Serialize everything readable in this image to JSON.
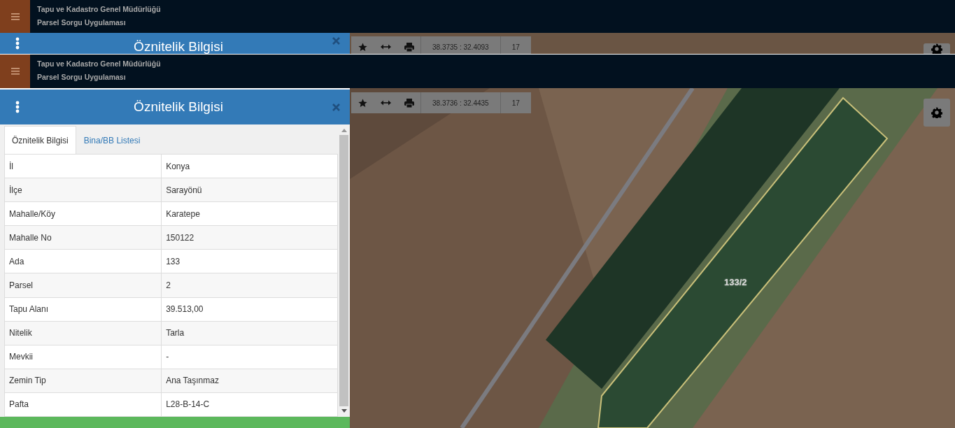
{
  "frames": [
    {
      "header": {
        "title": "Tapu ve Kadastro Genel Müdürlüğü",
        "subtitle": "Parsel Sorgu Uygulaması"
      },
      "panel": {
        "title": "Öznitelik Bilgisi"
      },
      "toolbar": {
        "coordinates": "38.3735 : 32.4093",
        "zoom": "17"
      }
    },
    {
      "header": {
        "title": "Tapu ve Kadastro Genel Müdürlüğü",
        "subtitle": "Parsel Sorgu Uygulaması"
      },
      "panel": {
        "title": "Öznitelik Bilgisi",
        "tabs": [
          {
            "label": "Öznitelik Bilgisi",
            "selected": true
          },
          {
            "label": "Bina/BB Listesi",
            "selected": false
          }
        ],
        "rows": [
          {
            "label": "İl",
            "value": "Konya"
          },
          {
            "label": "İlçe",
            "value": "Sarayönü"
          },
          {
            "label": "Mahalle/Köy",
            "value": "Karatepe"
          },
          {
            "label": "Mahalle No",
            "value": "150122"
          },
          {
            "label": "Ada",
            "value": "133"
          },
          {
            "label": "Parsel",
            "value": "2"
          },
          {
            "label": "Tapu Alanı",
            "value": "39.513,00"
          },
          {
            "label": "Nitelik",
            "value": "Tarla"
          },
          {
            "label": "Mevkii",
            "value": "-"
          },
          {
            "label": "Zemin Tip",
            "value": "Ana Taşınmaz"
          },
          {
            "label": "Pafta",
            "value": "L28-B-14-C"
          }
        ]
      },
      "toolbar": {
        "coordinates": "38.3736 : 32.4435",
        "zoom": "17"
      },
      "map": {
        "parcel_label": "133/2"
      }
    }
  ]
}
